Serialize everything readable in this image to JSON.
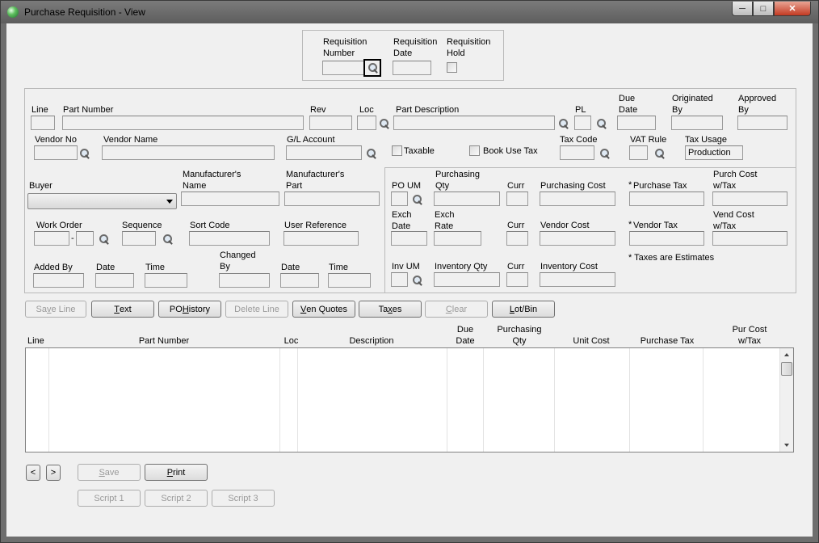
{
  "window": {
    "title": "Purchase Requisition - View"
  },
  "header": {
    "req_number_label": [
      "Requisition",
      "Number"
    ],
    "req_date_label": [
      "Requisition",
      "Date"
    ],
    "req_hold_label": [
      "Requisition",
      "Hold"
    ]
  },
  "line": {
    "line_label": "Line",
    "part_number_label": "Part Number",
    "rev_label": "Rev",
    "loc_label": "Loc",
    "part_desc_label": "Part Description",
    "pl_label": "PL",
    "due_date_label": [
      "Due",
      "Date"
    ],
    "originated_label": [
      "Originated",
      "By"
    ],
    "approved_label": [
      "Approved",
      "By"
    ],
    "vendor_no_label": "Vendor No",
    "vendor_name_label": "Vendor Name",
    "gl_account_label": "G/L Account",
    "taxable_label": "Taxable",
    "book_use_tax_label": "Book Use Tax",
    "tax_code_label": "Tax Code",
    "vat_rule_label": "VAT Rule",
    "tax_usage_label": "Tax Usage",
    "tax_usage_value": "Production",
    "buyer_label": "Buyer",
    "mfr_name_label": [
      "Manufacturer's",
      "Name"
    ],
    "mfr_part_label": [
      "Manufacturer's",
      "Part"
    ],
    "work_order_label": "Work Order",
    "work_order_sep": "-",
    "sequence_label": "Sequence",
    "sort_code_label": "Sort Code",
    "user_ref_label": "User Reference",
    "added_by_label": "Added By",
    "date_label": "Date",
    "time_label": "Time",
    "changed_by_label": [
      "Changed",
      "By"
    ],
    "date2_label": "Date",
    "time2_label": "Time"
  },
  "costs": {
    "po_um_label": "PO UM",
    "purch_qty_label": [
      "Purchasing",
      "Qty"
    ],
    "curr1_label": "Curr",
    "purch_cost_label": "Purchasing Cost",
    "purchase_tax_star": "*",
    "purchase_tax_label": "Purchase Tax",
    "purch_cost_tax_label": [
      "Purch Cost",
      "w/Tax"
    ],
    "exch_date_label": [
      "Exch",
      "Date"
    ],
    "exch_rate_label": [
      "Exch",
      "Rate"
    ],
    "curr2_label": "Curr",
    "vendor_cost_label": "Vendor Cost",
    "vendor_tax_star": "*",
    "vendor_tax_label": "Vendor Tax",
    "vend_cost_tax_label": [
      "Vend Cost",
      "w/Tax"
    ],
    "inv_um_label": "Inv UM",
    "inv_qty_label": "Inventory Qty",
    "curr3_label": "Curr",
    "inv_cost_label": "Inventory Cost",
    "taxes_note": "* Taxes are Estimates"
  },
  "toolbar": [
    {
      "pre": "Sa",
      "u": "v",
      "post": "e Line"
    },
    {
      "pre": "",
      "u": "T",
      "post": "ext"
    },
    {
      "pre": "PO ",
      "u": "H",
      "post": "istory"
    },
    {
      "pre": "Delete Line",
      "u": "",
      "post": ""
    },
    {
      "pre": "",
      "u": "V",
      "post": "en Quotes"
    },
    {
      "pre": "Ta",
      "u": "x",
      "post": "es"
    },
    {
      "pre": "",
      "u": "C",
      "post": "lear"
    },
    {
      "pre": "",
      "u": "L",
      "post": "ot/Bin"
    }
  ],
  "grid": {
    "headers": [
      [
        "Line"
      ],
      [
        "Part Number"
      ],
      [
        "Loc"
      ],
      [
        "Description"
      ],
      [
        "Due",
        "Date"
      ],
      [
        "Purchasing",
        "Qty"
      ],
      [
        "Unit Cost"
      ],
      [
        "Purchase Tax"
      ],
      [
        "Pur Cost",
        "w/Tax"
      ]
    ]
  },
  "nav": {
    "prev": "<",
    "next": ">"
  },
  "footer": {
    "save": {
      "pre": "",
      "u": "S",
      "post": "ave"
    },
    "print": {
      "pre": "",
      "u": "P",
      "post": "rint"
    },
    "script1": "Script 1",
    "script2": "Script 2",
    "script3": "Script 3"
  }
}
